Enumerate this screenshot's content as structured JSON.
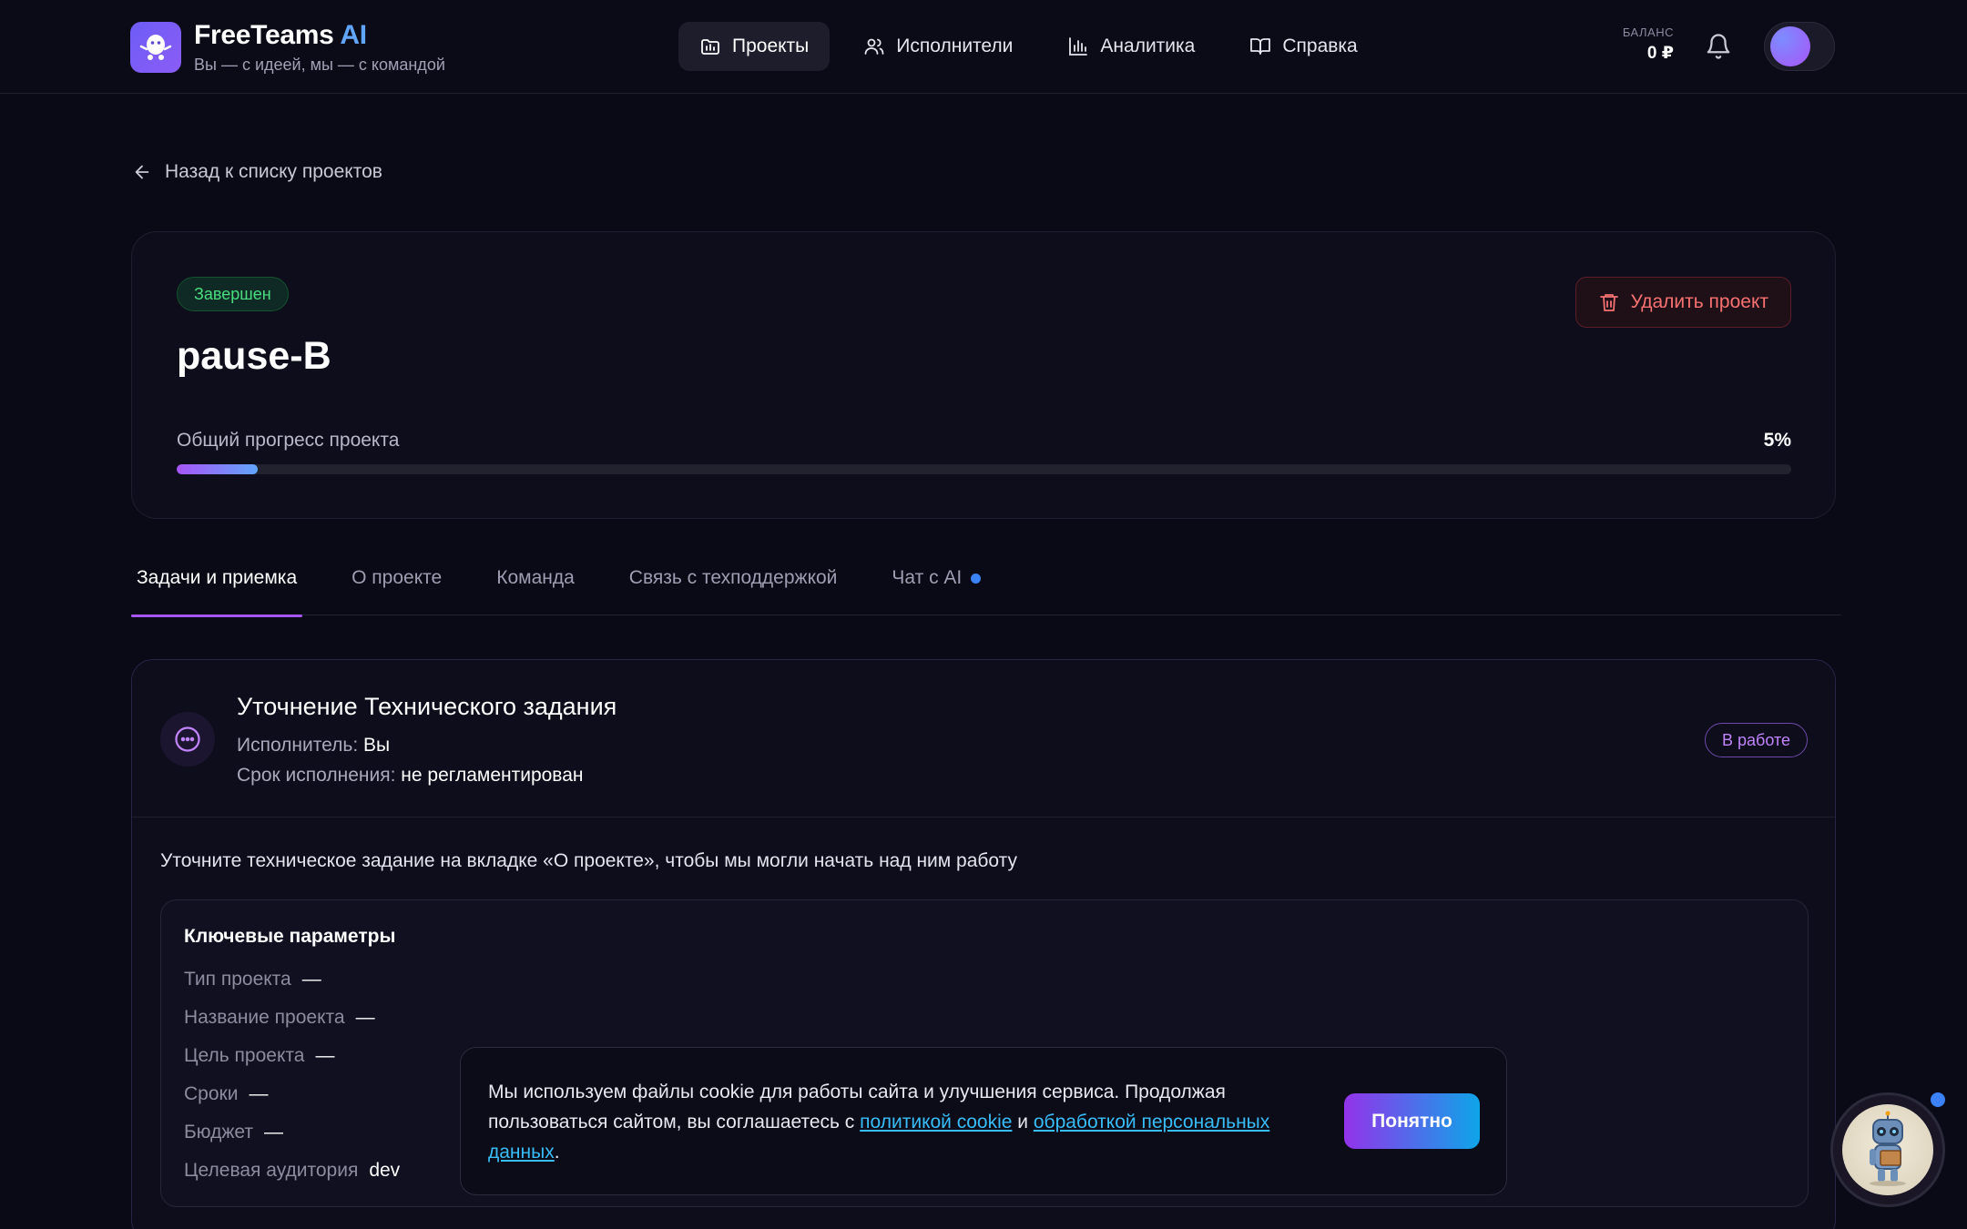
{
  "header": {
    "brand_name": "FreeTeams",
    "brand_ai": "AI",
    "brand_sub": "Вы — с идеей, мы — с командой",
    "nav": [
      {
        "label": "Проекты",
        "icon": "projects-icon",
        "active": true
      },
      {
        "label": "Исполнители",
        "icon": "users-icon",
        "active": false
      },
      {
        "label": "Аналитика",
        "icon": "chart-icon",
        "active": false
      },
      {
        "label": "Справка",
        "icon": "book-icon",
        "active": false
      }
    ],
    "balance_label": "БАЛАНС",
    "balance_value": "0 ₽"
  },
  "back_link": "Назад к списку проектов",
  "project": {
    "status": "Завершен",
    "title": "pause-B",
    "delete_label": "Удалить проект",
    "progress_label": "Общий прогресс проекта",
    "progress_value": "5%",
    "progress_fraction": 0.05
  },
  "tabs": [
    {
      "label": "Задачи и приемка",
      "active": true
    },
    {
      "label": "О проекте",
      "active": false
    },
    {
      "label": "Команда",
      "active": false
    },
    {
      "label": "Связь с техподдержкой",
      "active": false
    },
    {
      "label": "Чат с AI",
      "active": false
    }
  ],
  "task": {
    "title": "Уточнение Технического задания",
    "executor_label": "Исполнитель:",
    "executor_value": "Вы",
    "deadline_label": "Срок исполнения:",
    "deadline_value": "не регламентирован",
    "status": "В работе",
    "description": "Уточните техническое задание на вкладке «О проекте», чтобы мы могли начать над ним работу",
    "params_title": "Ключевые параметры",
    "params": [
      {
        "label": "Тип проекта",
        "value": "—"
      },
      {
        "label": "Название проекта",
        "value": "—"
      },
      {
        "label": "Цель проекта",
        "value": "—"
      },
      {
        "label": "Сроки",
        "value": "—"
      },
      {
        "label": "Бюджет",
        "value": "—"
      },
      {
        "label": "Целевая аудитория",
        "value": "dev"
      }
    ]
  },
  "cookie": {
    "text_1": "Мы используем файлы cookie для работы сайта и улучшения сервиса. Продолжая пользоваться сайтом, вы соглашаетесь с ",
    "link_1": "политикой cookie",
    "text_2": " и ",
    "link_2": "обработкой персональных данных",
    "text_3": ".",
    "button": "Понятно"
  },
  "colors": {
    "background": "#0a0a17",
    "accent_purple": "#a855f7",
    "accent_blue": "#3b82f6",
    "status_green": "#4ade80",
    "danger": "#f87171"
  }
}
